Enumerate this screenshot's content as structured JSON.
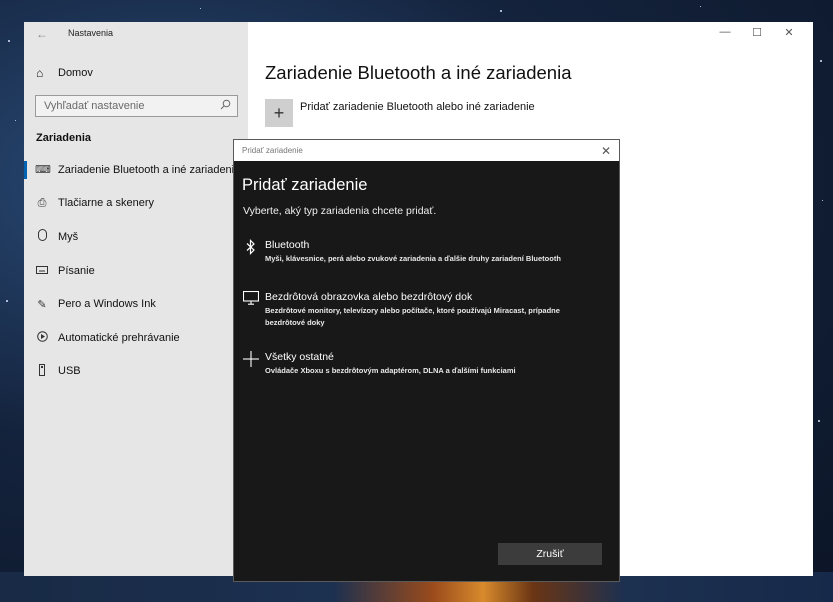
{
  "settings": {
    "app_title": "Nastavenia",
    "back_glyph": "←",
    "home_label": "Domov",
    "search_placeholder": "Vyhľadať nastavenie",
    "section_title": "Zariadenia",
    "nav_items": [
      {
        "label": "Zariadenie Bluetooth a iné zariadenia",
        "icon": "bluetooth-devices-icon",
        "selected": true
      },
      {
        "label": "Tlačiarne a skenery",
        "icon": "printer-icon",
        "selected": false
      },
      {
        "label": "Myš",
        "icon": "mouse-icon",
        "selected": false
      },
      {
        "label": "Písanie",
        "icon": "keyboard-icon",
        "selected": false
      },
      {
        "label": "Pero a Windows Ink",
        "icon": "pen-icon",
        "selected": false
      },
      {
        "label": "Automatické prehrávanie",
        "icon": "autoplay-icon",
        "selected": false
      },
      {
        "label": "USB",
        "icon": "usb-icon",
        "selected": false
      }
    ],
    "page_title": "Zariadenie Bluetooth a iné zariadenia",
    "add_device_label": "Pridať zariadenie Bluetooth alebo iné zariadenie"
  },
  "dialog": {
    "window_title": "Pridať zariadenie",
    "heading": "Pridať zariadenie",
    "prompt": "Vyberte, aký typ zariadenia chcete pridať.",
    "options": [
      {
        "title": "Bluetooth",
        "desc": "Myši, klávesnice, perá alebo zvukové zariadenia a ďalšie druhy zariadení Bluetooth",
        "icon": "bluetooth-icon"
      },
      {
        "title": "Bezdrôtová obrazovka alebo bezdrôtový dok",
        "desc": "Bezdrôtové monitory, televízory alebo počítače, ktoré používajú Miracast, prípadne bezdrôtové doky",
        "icon": "monitor-icon"
      },
      {
        "title": "Všetky ostatné",
        "desc": "Ovládače Xboxu s bezdrôtovým adaptérom, DLNA a ďalšími funkciami",
        "icon": "plus-icon"
      }
    ],
    "cancel_label": "Zrušiť"
  },
  "colors": {
    "accent": "#0063b1",
    "dialog_bg": "#181818",
    "sidebar_bg": "#e6e6e6"
  }
}
